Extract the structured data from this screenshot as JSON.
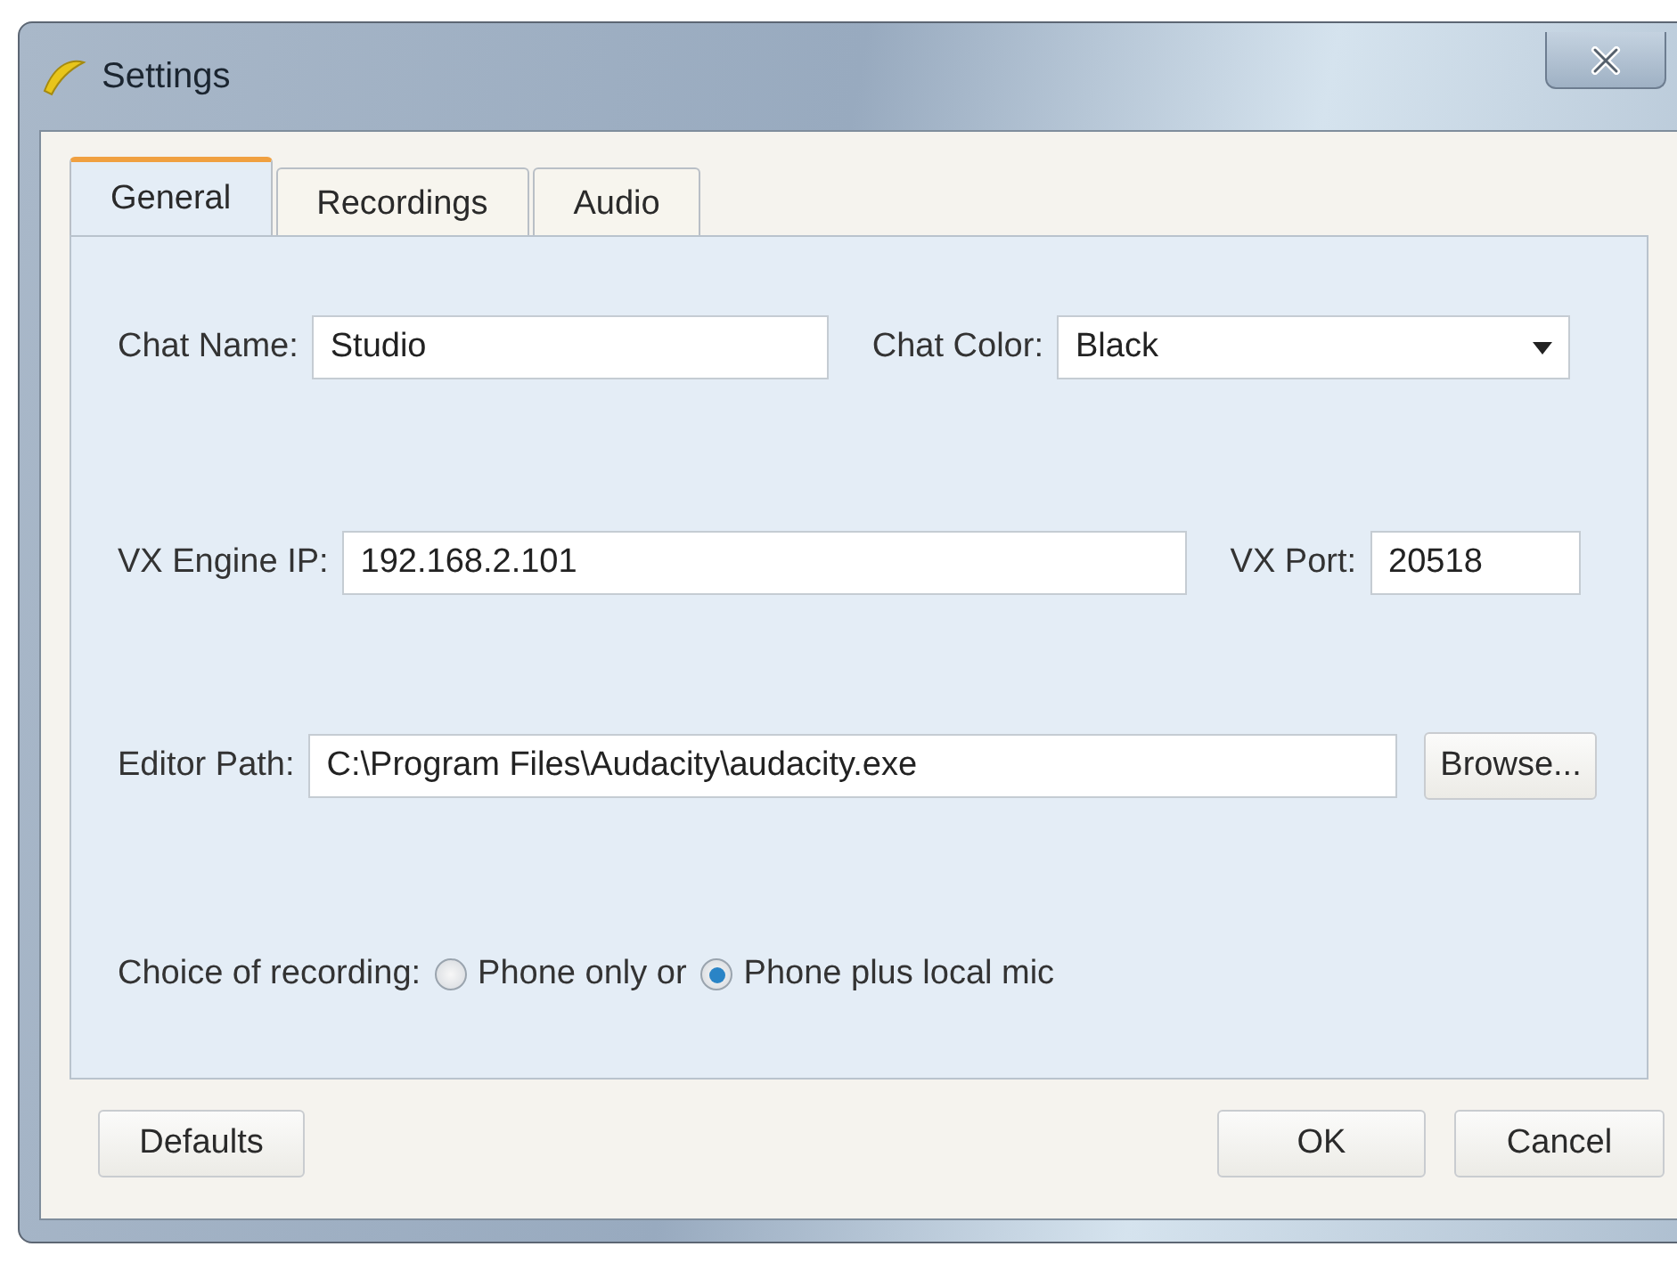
{
  "window": {
    "title": "Settings"
  },
  "tabs": [
    {
      "label": "General",
      "selected": true
    },
    {
      "label": "Recordings",
      "selected": false
    },
    {
      "label": "Audio",
      "selected": false
    }
  ],
  "chat_name": {
    "label": "Chat Name:",
    "value": "Studio"
  },
  "chat_color": {
    "label": "Chat Color:",
    "value": "Black"
  },
  "engine_ip": {
    "label": "VX Engine IP:",
    "value": "192.168.2.101"
  },
  "port": {
    "label": "VX Port:",
    "value": "20518"
  },
  "editor_path": {
    "label": "Editor Path:",
    "value": "C:\\Program Files\\Audacity\\audacity.exe",
    "button": "Browse..."
  },
  "recording": {
    "label": "Choice of recording:",
    "options": [
      {
        "label": "Phone only or",
        "selected": false
      },
      {
        "label": "Phone plus local mic",
        "selected": true
      }
    ]
  },
  "buttons": {
    "defaults": "Defaults",
    "ok": "OK",
    "cancel": "Cancel"
  }
}
